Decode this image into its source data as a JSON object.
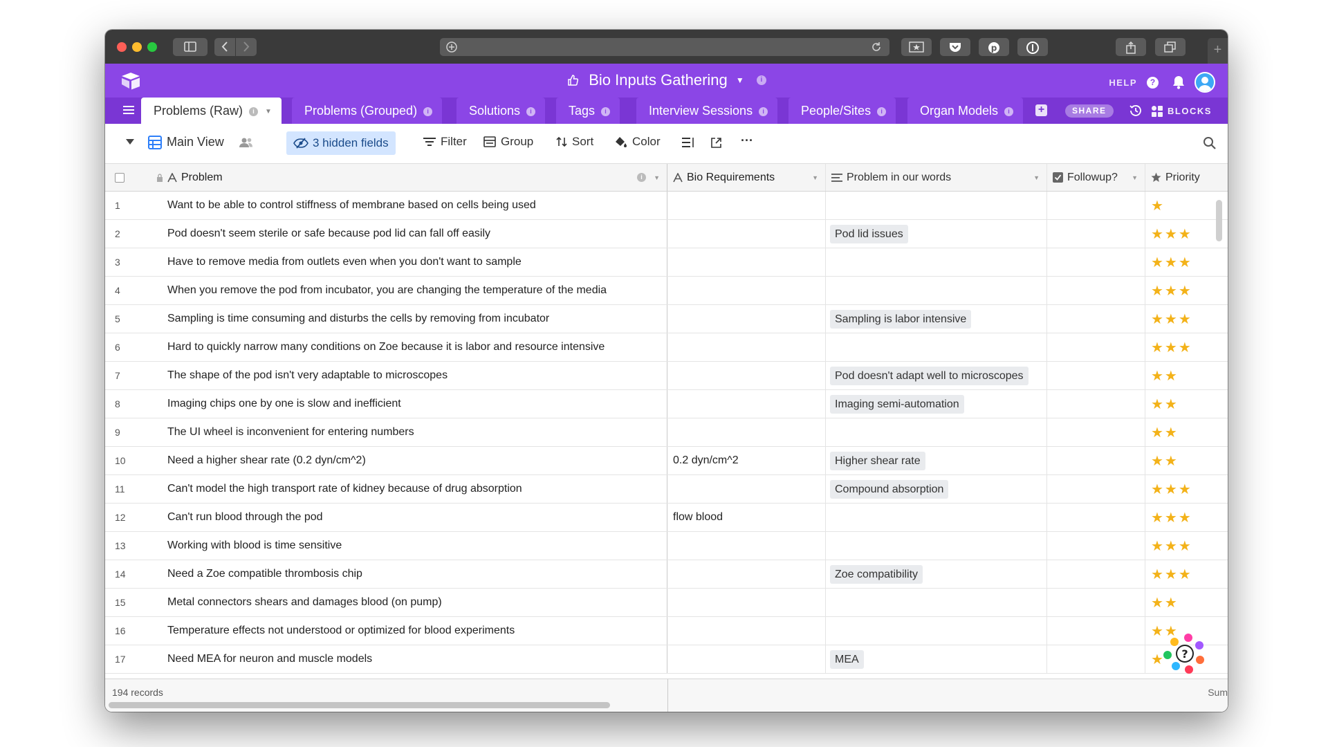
{
  "browser": {
    "newtab_label": "+"
  },
  "header": {
    "base_title": "Bio Inputs Gathering",
    "help_label": "HELP"
  },
  "tabs": [
    {
      "label": "Problems (Raw)",
      "active": true
    },
    {
      "label": "Problems (Grouped)",
      "active": false
    },
    {
      "label": "Solutions",
      "active": false
    },
    {
      "label": "Tags",
      "active": false
    },
    {
      "label": "Interview Sessions",
      "active": false
    },
    {
      "label": "People/Sites",
      "active": false
    },
    {
      "label": "Organ Models",
      "active": false
    }
  ],
  "tabbar": {
    "share_label": "SHARE",
    "blocks_label": "BLOCKS"
  },
  "viewbar": {
    "view_name": "Main View",
    "hidden_fields": "3 hidden fields",
    "filter": "Filter",
    "group": "Group",
    "color": "Color",
    "sort": "Sort",
    "more": "···"
  },
  "columns": {
    "problem": "Problem",
    "bio": "Bio Requirements",
    "words": "Problem in our words",
    "followup": "Followup?",
    "priority": "Priority"
  },
  "rows": [
    {
      "num": "1",
      "problem": "Want to be able to control stiffness of membrane based on cells being used",
      "bio": "",
      "words": "",
      "priority": 1
    },
    {
      "num": "2",
      "problem": "Pod doesn't seem sterile or safe because pod lid can fall off easily",
      "bio": "",
      "words": "Pod lid issues",
      "priority": 3
    },
    {
      "num": "3",
      "problem": "Have to remove media from outlets even when you don't want to sample",
      "bio": "",
      "words": "",
      "priority": 3
    },
    {
      "num": "4",
      "problem": "When you remove the pod from incubator, you are changing the temperature of the media",
      "bio": "",
      "words": "",
      "priority": 3
    },
    {
      "num": "5",
      "problem": "Sampling is time consuming and disturbs the cells by removing from incubator",
      "bio": "",
      "words": "Sampling is labor intensive",
      "priority": 3
    },
    {
      "num": "6",
      "problem": "Hard to quickly narrow many conditions on Zoe because it is labor and resource intensive",
      "bio": "",
      "words": "",
      "priority": 3
    },
    {
      "num": "7",
      "problem": "The shape of the pod isn't very adaptable to microscopes",
      "bio": "",
      "words": "Pod doesn't adapt well to microscopes",
      "priority": 2
    },
    {
      "num": "8",
      "problem": "Imaging chips one by one is slow and inefficient",
      "bio": "",
      "words": "Imaging semi-automation",
      "priority": 2
    },
    {
      "num": "9",
      "problem": "The UI wheel is inconvenient for entering numbers",
      "bio": "",
      "words": "",
      "priority": 2
    },
    {
      "num": "10",
      "problem": "Need a higher shear rate (0.2 dyn/cm^2)",
      "bio": "0.2 dyn/cm^2",
      "words": "Higher shear rate",
      "priority": 2
    },
    {
      "num": "11",
      "problem": "Can't model the high transport rate of kidney because of drug absorption",
      "bio": "",
      "words": "Compound absorption",
      "priority": 3
    },
    {
      "num": "12",
      "problem": "Can't run blood through the pod",
      "bio": "flow blood",
      "words": "",
      "priority": 3
    },
    {
      "num": "13",
      "problem": "Working with blood is time sensitive",
      "bio": "",
      "words": "",
      "priority": 3
    },
    {
      "num": "14",
      "problem": "Need a Zoe compatible thrombosis chip",
      "bio": "",
      "words": "Zoe compatibility",
      "priority": 3
    },
    {
      "num": "15",
      "problem": "Metal connectors shears and damages blood (on pump)",
      "bio": "",
      "words": "",
      "priority": 2
    },
    {
      "num": "16",
      "problem": "Temperature effects not understood or optimized for blood experiments",
      "bio": "",
      "words": "",
      "priority": 2
    },
    {
      "num": "17",
      "problem": "Need MEA for neuron and muscle models",
      "bio": "",
      "words": "MEA",
      "priority": 1
    }
  ],
  "footer": {
    "record_count": "194 records",
    "sum_label": "Sum"
  },
  "colors": {
    "brand_purple": "#8b46e6",
    "tab_bar_purple": "#7a36d4",
    "star": "#f3b219"
  }
}
